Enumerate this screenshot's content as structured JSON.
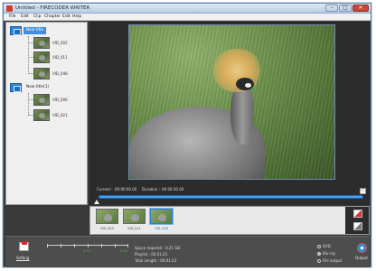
{
  "window": {
    "title": "Untitled - FIRECODER WRITER",
    "controls": [
      "–",
      "□",
      "✕"
    ]
  },
  "menu": [
    "File",
    "Edit",
    "Clip",
    "Chapter",
    "Edit",
    "Help"
  ],
  "titles": [
    {
      "label": "New title",
      "selected": true,
      "clips": [
        "VID_002",
        "VID_011",
        "VID_048"
      ]
    },
    {
      "label": "New title(1)",
      "selected": false,
      "clips": [
        "VID_006",
        "VID_021"
      ]
    }
  ],
  "player": {
    "current_label": "Current :",
    "current_value": "00:00:00.00",
    "duration_label": "Duration :",
    "duration_value": "00:00:30.00",
    "progress": 0.0
  },
  "strip": {
    "clips": [
      {
        "label": "VID_002",
        "selected": false
      },
      {
        "label": "VID_011",
        "selected": false
      },
      {
        "label": "VID_048",
        "selected": true
      }
    ]
  },
  "bottom": {
    "setting_label": "Setting",
    "scale_left": "4.7G",
    "scale_right": "9.4G",
    "space_required": "Space required : 0.21 GB",
    "playlist": "Playlist :       00:01:23",
    "total_length": "Total Length :       00:01:23",
    "options": [
      {
        "label": "DVD",
        "selected": false
      },
      {
        "label": "Blu-ray",
        "selected": true
      },
      {
        "label": "File output",
        "selected": false
      }
    ],
    "output_label": "Output"
  }
}
